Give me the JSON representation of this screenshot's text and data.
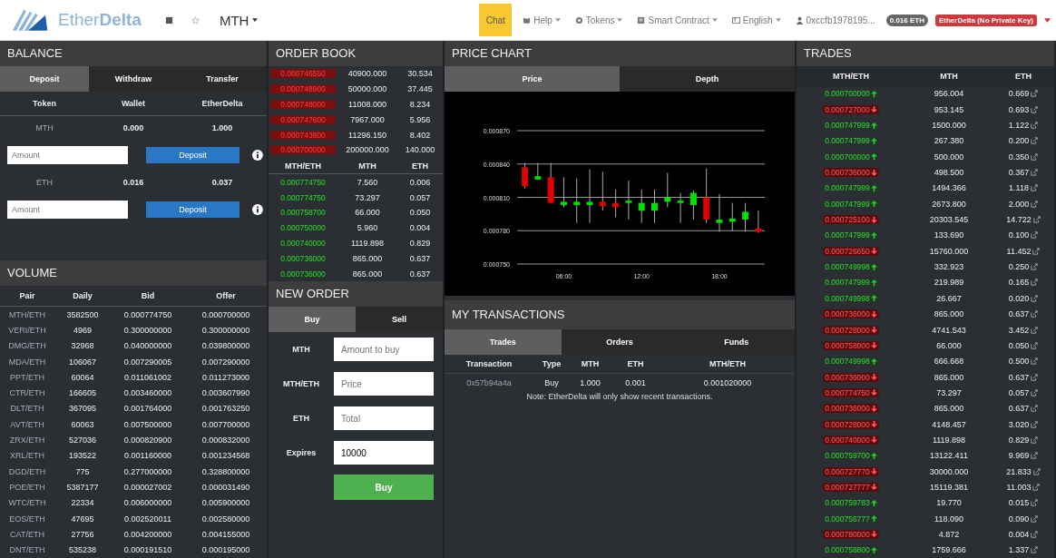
{
  "navbar": {
    "brand": "Ether**Delta**",
    "token_menu": "MTH",
    "chat": "Chat",
    "menus": [
      {
        "kind": "help",
        "label": "Help"
      },
      {
        "kind": "tokens",
        "label": "Tokens"
      },
      {
        "kind": "contract",
        "label": "Smart Contract"
      },
      {
        "kind": "language",
        "label": "English"
      }
    ],
    "account": "0xccfb1978195...",
    "eth_badge": "0.016 ETH",
    "key_badge": "EtherDelta (No Private Key)"
  },
  "balance": {
    "title": "BALANCE",
    "tabs": [
      {
        "label": "Deposit",
        "selected": true
      },
      {
        "label": "Withdraw",
        "selected": false
      },
      {
        "label": "Transfer",
        "selected": false
      }
    ],
    "columns": [
      "Token",
      "Wallet",
      "EtherDelta"
    ],
    "rows": [
      {
        "token": "MTH",
        "wallet": "0.000",
        "etherdelta": "1.000",
        "placeholder": "Amount",
        "button": "Deposit"
      },
      {
        "token": "ETH",
        "wallet": "0.016",
        "etherdelta": "0.037",
        "placeholder": "Amount",
        "button": "Deposit"
      }
    ]
  },
  "volume": {
    "title": "VOLUME",
    "columns": [
      "Pair",
      "Daily",
      "Bid",
      "Offer"
    ],
    "rows": [
      [
        "MTH/ETH",
        "3582500",
        "0.000774750",
        "0.000700000"
      ],
      [
        "VERI/ETH",
        "4969",
        "0.300000000",
        "0.300000000"
      ],
      [
        "DMG/ETH",
        "32968",
        "0.040000000",
        "0.039800000"
      ],
      [
        "MDA/ETH",
        "106067",
        "0.007290005",
        "0.007290000"
      ],
      [
        "PPT/ETH",
        "60064",
        "0.011061002",
        "0.011273000"
      ],
      [
        "CTR/ETH",
        "166605",
        "0.003460000",
        "0.003607990"
      ],
      [
        "DLT/ETH",
        "367095",
        "0.001764000",
        "0.001763250"
      ],
      [
        "AVT/ETH",
        "60063",
        "0.007500000",
        "0.007700000"
      ],
      [
        "ZRX/ETH",
        "527036",
        "0.000820900",
        "0.000832000"
      ],
      [
        "XRL/ETH",
        "193522",
        "0.001160000",
        "0.001234568"
      ],
      [
        "DGD/ETH",
        "775",
        "0.277000000",
        "0.328800000"
      ],
      [
        "POE/ETH",
        "5387177",
        "0.000027002",
        "0.000031490"
      ],
      [
        "WTC/ETH",
        "22334",
        "0.006000000",
        "0.005900000"
      ],
      [
        "EOS/ETH",
        "47695",
        "0.002520011",
        "0.002580000"
      ],
      [
        "CAT/ETH",
        "27756",
        "0.004200000",
        "0.004155000"
      ],
      [
        "DNT/ETH",
        "535238",
        "0.000191510",
        "0.000195000"
      ]
    ]
  },
  "order_book": {
    "title": "ORDER BOOK",
    "asks": [
      [
        "0.000746550",
        "40900.000",
        "30.534"
      ],
      [
        "0.000748900",
        "50000.000",
        "37.445"
      ],
      [
        "0.000748000",
        "11008.000",
        "8.234"
      ],
      [
        "0.000747600",
        "7967.000",
        "5.956"
      ],
      [
        "0.000743800",
        "11296.150",
        "8.402"
      ],
      [
        "0.000700000",
        "200000.000",
        "140.000"
      ]
    ],
    "columns": [
      "MTH/ETH",
      "MTH",
      "ETH"
    ],
    "bids": [
      [
        "0.000774750",
        "7.560",
        "0.006"
      ],
      [
        "0.000774750",
        "73.297",
        "0.057"
      ],
      [
        "0.000758700",
        "66.000",
        "0.050"
      ],
      [
        "0.000750000",
        "5.960",
        "0.004"
      ],
      [
        "0.000740000",
        "1119.898",
        "0.829"
      ],
      [
        "0.000736000",
        "865.000",
        "0.637"
      ],
      [
        "0.000736000",
        "865.000",
        "0.637"
      ]
    ]
  },
  "new_order": {
    "title": "NEW ORDER",
    "tabs": [
      {
        "label": "Buy",
        "selected": true
      },
      {
        "label": "Sell",
        "selected": false
      }
    ],
    "fields": [
      {
        "label": "MTH",
        "placeholder": "Amount to buy"
      },
      {
        "label": "MTH/ETH",
        "placeholder": "Price"
      },
      {
        "label": "ETH",
        "placeholder": "Total"
      },
      {
        "label": "Expires",
        "value": "10000"
      }
    ],
    "submit": "Buy"
  },
  "price_chart": {
    "title": "PRICE CHART",
    "tabs": [
      {
        "label": "Price",
        "selected": true
      },
      {
        "label": "Depth",
        "selected": false
      }
    ],
    "chart_data": {
      "type": "candlestick",
      "x": [
        3,
        4,
        5,
        6,
        7,
        8,
        9,
        10,
        11,
        12,
        13,
        14,
        15,
        16,
        17,
        18,
        19,
        20,
        21
      ],
      "ohlc": [
        [
          0.000837,
          0.000841,
          0.000818,
          0.00082
        ],
        [
          0.000826,
          0.000841,
          0.000826,
          0.000829
        ],
        [
          0.000828,
          0.000841,
          0.000805,
          0.000805
        ],
        [
          0.000803,
          0.000828,
          0.000801,
          0.000806
        ],
        [
          0.000803,
          0.000827,
          0.000787,
          0.000806
        ],
        [
          0.000803,
          0.000835,
          0.000787,
          0.000806
        ],
        [
          0.000806,
          0.000833,
          0.000798,
          0.000802
        ],
        [
          0.000805,
          0.000817,
          0.000792,
          0.000801
        ],
        [
          0.000805,
          0.000825,
          0.00079,
          0.000807
        ],
        [
          0.000798,
          0.000817,
          0.000787,
          0.000805
        ],
        [
          0.000798,
          0.000817,
          0.000787,
          0.000805
        ],
        [
          0.000806,
          0.000832,
          0.000801,
          0.00081
        ],
        [
          0.000805,
          0.000814,
          0.000787,
          0.000807
        ],
        [
          0.000803,
          0.000816,
          0.00079,
          0.000814
        ],
        [
          0.00081,
          0.000836,
          0.000787,
          0.00079
        ],
        [
          0.000787,
          0.000813,
          0.000779,
          0.00079
        ],
        [
          0.000788,
          0.000805,
          0.00078,
          0.000791
        ],
        [
          0.00079,
          0.000805,
          0.000779,
          0.000797
        ],
        [
          0.000782,
          0.000798,
          0.000778,
          0.000779
        ]
      ],
      "xlim": [
        2.4,
        21.5
      ],
      "ylim": [
        0.00075,
        0.00087
      ],
      "grid": true,
      "xticks": [
        {
          "value": 6,
          "label": "06:00"
        },
        {
          "value": 12,
          "label": "12:00"
        },
        {
          "value": 18,
          "label": "18:00"
        }
      ],
      "yticks": [
        {
          "value": 0.00087,
          "label": "0.000870"
        },
        {
          "value": 0.00084,
          "label": "0.000840"
        },
        {
          "value": 0.00081,
          "label": "0.000810"
        },
        {
          "value": 0.00078,
          "label": "0.000780"
        },
        {
          "value": 0.00075,
          "label": "0.000750"
        }
      ]
    }
  },
  "my_transactions": {
    "title": "MY TRANSACTIONS",
    "tabs": [
      {
        "label": "Trades",
        "selected": true
      },
      {
        "label": "Orders",
        "selected": false
      },
      {
        "label": "Funds",
        "selected": false
      }
    ],
    "columns": [
      "Transaction",
      "Type",
      "MTH",
      "ETH",
      "MTH/ETH"
    ],
    "rows": [
      [
        "0x57b94a4a",
        "Buy",
        "1.000",
        "0.001",
        "0.001020000"
      ]
    ],
    "note": "Note: EtherDelta will only show recent transactions."
  },
  "trades": {
    "title": "TRADES",
    "columns": [
      "MTH/ETH",
      "MTH",
      "ETH"
    ],
    "rows": [
      {
        "price": "0.000700000",
        "amount": "956.004",
        "total": "0.669",
        "kind": "buy"
      },
      {
        "price": "0.000727000",
        "amount": "953.145",
        "total": "0.693",
        "kind": "sell"
      },
      {
        "price": "0.000747999",
        "amount": "1500.000",
        "total": "1.122",
        "kind": "buy"
      },
      {
        "price": "0.000747999",
        "amount": "267.380",
        "total": "0.200",
        "kind": "buy"
      },
      {
        "price": "0.000700000",
        "amount": "500.000",
        "total": "0.350",
        "kind": "buy"
      },
      {
        "price": "0.000736000",
        "amount": "498.500",
        "total": "0.367",
        "kind": "sell"
      },
      {
        "price": "0.000747999",
        "amount": "1494.366",
        "total": "1.118",
        "kind": "buy"
      },
      {
        "price": "0.000747999",
        "amount": "2673.800",
        "total": "2.000",
        "kind": "buy"
      },
      {
        "price": "0.000725100",
        "amount": "20303.545",
        "total": "14.722",
        "kind": "sell"
      },
      {
        "price": "0.000747999",
        "amount": "133.690",
        "total": "0.100",
        "kind": "buy"
      },
      {
        "price": "0.000726650",
        "amount": "15760.000",
        "total": "11.452",
        "kind": "sell"
      },
      {
        "price": "0.000749998",
        "amount": "332.923",
        "total": "0.250",
        "kind": "buy"
      },
      {
        "price": "0.000747999",
        "amount": "219.989",
        "total": "0.165",
        "kind": "buy"
      },
      {
        "price": "0.000749998",
        "amount": "26.667",
        "total": "0.020",
        "kind": "buy"
      },
      {
        "price": "0.000736000",
        "amount": "865.000",
        "total": "0.637",
        "kind": "sell"
      },
      {
        "price": "0.000728000",
        "amount": "4741.543",
        "total": "3.452",
        "kind": "sell"
      },
      {
        "price": "0.000758000",
        "amount": "66.000",
        "total": "0.050",
        "kind": "sell"
      },
      {
        "price": "0.000749998",
        "amount": "666.668",
        "total": "0.500",
        "kind": "buy"
      },
      {
        "price": "0.000736000",
        "amount": "865.000",
        "total": "0.637",
        "kind": "sell"
      },
      {
        "price": "0.000774750",
        "amount": "73.297",
        "total": "0.057",
        "kind": "sell"
      },
      {
        "price": "0.000736000",
        "amount": "865.000",
        "total": "0.637",
        "kind": "sell"
      },
      {
        "price": "0.000728000",
        "amount": "4148.457",
        "total": "3.020",
        "kind": "sell"
      },
      {
        "price": "0.000740000",
        "amount": "1119.898",
        "total": "0.829",
        "kind": "sell"
      },
      {
        "price": "0.000759700",
        "amount": "13122.411",
        "total": "9.969",
        "kind": "buy"
      },
      {
        "price": "0.000727770",
        "amount": "30000.000",
        "total": "21.833",
        "kind": "sell"
      },
      {
        "price": "0.000727777",
        "amount": "15119.381",
        "total": "11.003",
        "kind": "sell"
      },
      {
        "price": "0.000759783",
        "amount": "19.770",
        "total": "0.015",
        "kind": "buy"
      },
      {
        "price": "0.000756777",
        "amount": "118.090",
        "total": "0.090",
        "kind": "buy"
      },
      {
        "price": "0.000780000",
        "amount": "4.872",
        "total": "0.004",
        "kind": "sell"
      },
      {
        "price": "0.000758800",
        "amount": "1759.666",
        "total": "1.337",
        "kind": "buy"
      }
    ]
  }
}
